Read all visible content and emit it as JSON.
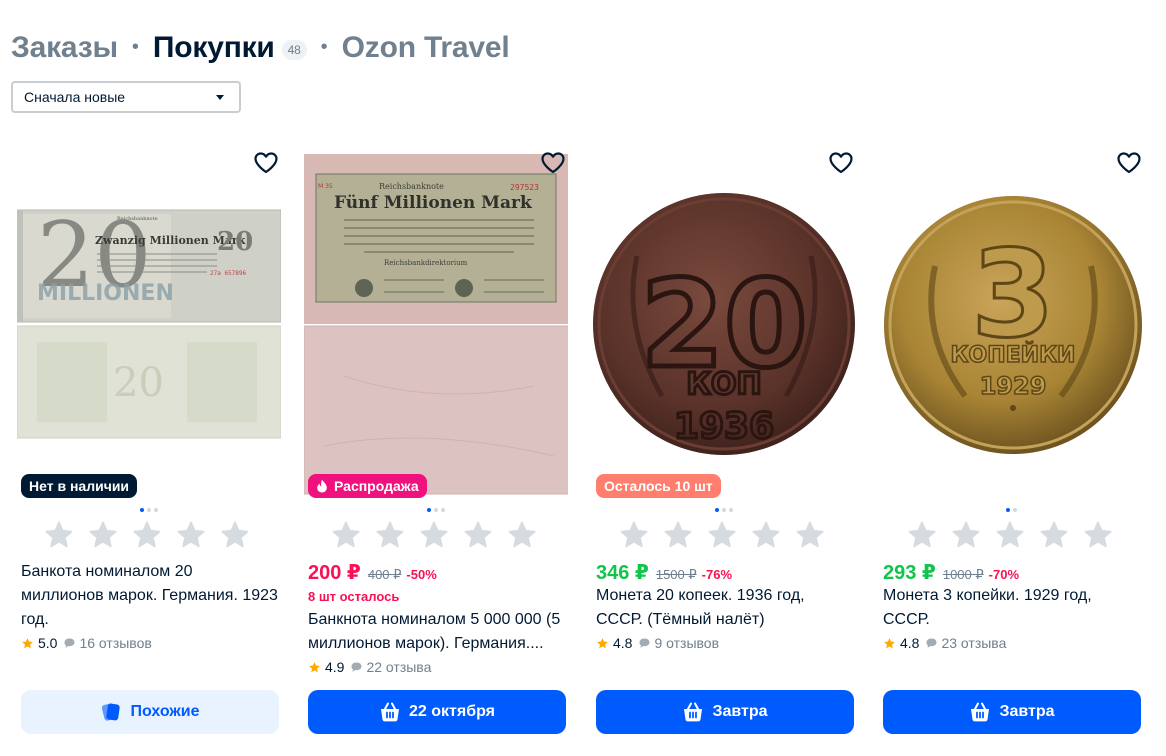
{
  "header": {
    "tabs": [
      {
        "label": "Заказы",
        "active": false
      },
      {
        "label": "Покупки",
        "active": true,
        "count": "48"
      },
      {
        "label": "Ozon Travel",
        "active": false
      }
    ],
    "separator": "•"
  },
  "sort": {
    "value": "Сначала новые"
  },
  "colors": {
    "blue": "#005bff",
    "pink": "#f91155",
    "green": "#10c44c",
    "salmon": "#ff7e6e",
    "black_tag": "#001a34",
    "star": "#ffa800"
  },
  "products": [
    {
      "image": "banknote 20 millionen mark, two sides",
      "tag": "Нет в наличии",
      "title": "Банкота номиналом 20 миллионов марок. Германия. 1923 год.",
      "rating": "5.0",
      "reviews": "16 отзывов",
      "button": "Похожие",
      "button_icon": "similar-cards-icon"
    },
    {
      "image": "banknote Fünf Millionen Mark, two sides",
      "tag": "Распродажа",
      "price": "200 ₽",
      "old_price": "400 ₽",
      "discount": "-50%",
      "left_note": "8 шт осталось",
      "title": "Банкнота номиналом 5 000 000 (5 миллионов марок). Германия....",
      "rating": "4.9",
      "reviews": "22 отзыва",
      "button": "22 октября",
      "button_icon": "cart-icon"
    },
    {
      "image": "coin 20 kopeks 1936",
      "tag": "Осталось 10 шт",
      "price": "346 ₽",
      "old_price": "1500 ₽",
      "discount": "-76%",
      "title": "Монета 20 копеек. 1936 год, СССР. (Тёмный налёт)",
      "rating": "4.8",
      "reviews": "9 отзывов",
      "button": "Завтра",
      "button_icon": "cart-icon"
    },
    {
      "image": "coin 3 kopeks 1929",
      "price": "293 ₽",
      "old_price": "1000 ₽",
      "discount": "-70%",
      "title": "Монета 3 копейки. 1929 год, СССР.",
      "rating": "4.8",
      "reviews": "23 отзыва",
      "button": "Завтра",
      "button_icon": "cart-icon"
    }
  ],
  "coin_texts": {
    "c20_value": "20",
    "c20_unit": "КОП",
    "c20_year": "1936",
    "c3_value": "3",
    "c3_unit": "КОПЕЙКИ",
    "c3_year": "1929"
  },
  "banknote_texts": {
    "n1_title": "Zwanzig Millionen Mark",
    "n1_value": "20",
    "n1_bank": "Reichsbanknote",
    "n1_serial": "27a 657896",
    "n1_back": "MILLIONEN",
    "n2_title": "Fünf Millionen Mark",
    "n2_bank": "Reichsbanknote",
    "n2_serial": "297523",
    "n2_series": "M 35",
    "n2_footer": "Reichsbankdirektorium"
  }
}
